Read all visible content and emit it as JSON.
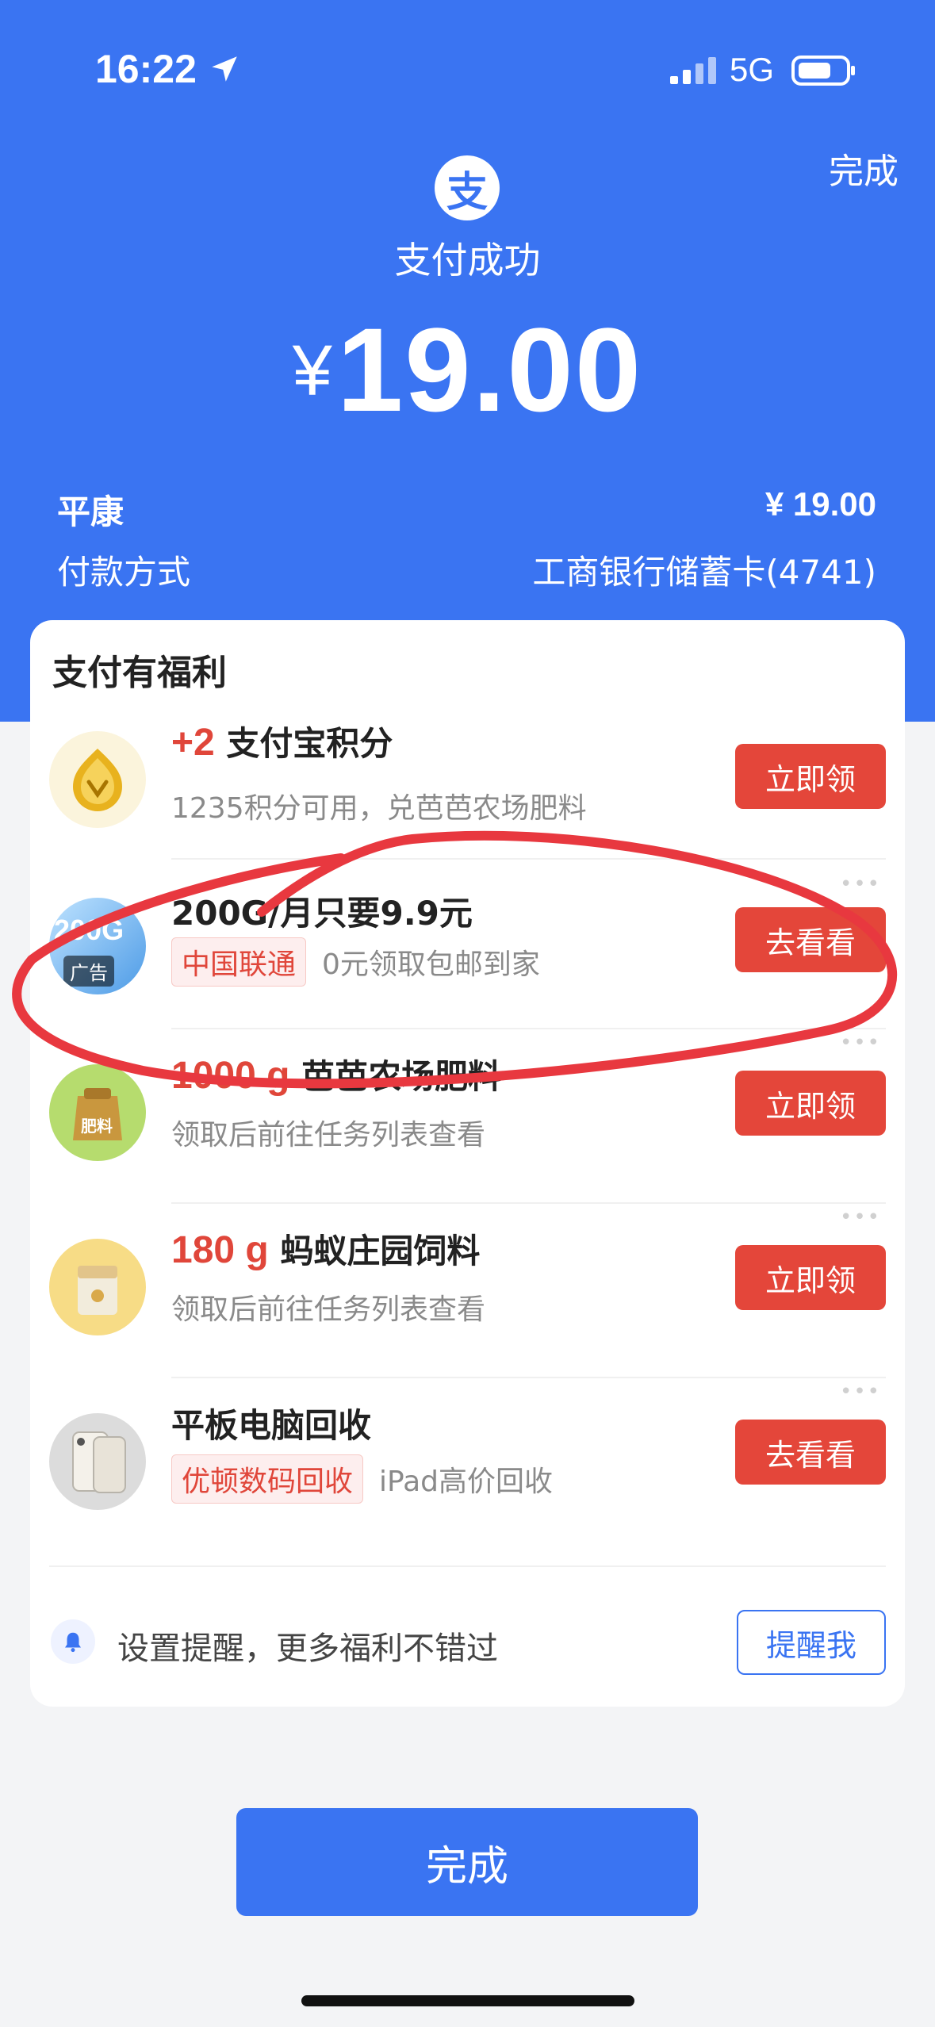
{
  "status_bar": {
    "time": "16:22",
    "network": "5G"
  },
  "header": {
    "done_label": "完成",
    "logo_char": "支",
    "status_text": "支付成功",
    "currency": "¥",
    "amount": "19.00"
  },
  "summary": {
    "merchant": "平康",
    "merchant_amount": "¥ 19.00",
    "method_label": "付款方式",
    "method_value": "工商银行储蓄卡(4741)"
  },
  "benefits": {
    "title": "支付有福利",
    "items": [
      {
        "highlight": "+2",
        "title": " 支付宝积分",
        "tag": "",
        "desc": "1235积分可用，兑芭芭农场肥料",
        "button": "立即领"
      },
      {
        "highlight": "",
        "title": "200G/月只要9.9元",
        "tag": "中国联通",
        "desc": "0元领取包邮到家",
        "button": "去看看",
        "ad_label": "广告",
        "avatar_text": "200G"
      },
      {
        "highlight": "1000 g",
        "title": " 芭芭农场肥料",
        "tag": "",
        "desc": "领取后前往任务列表查看",
        "button": "立即领",
        "avatar_text": "肥料"
      },
      {
        "highlight": "180 g",
        "title": " 蚂蚁庄园饲料",
        "tag": "",
        "desc": "领取后前往任务列表查看",
        "button": "立即领"
      },
      {
        "highlight": "",
        "title": "平板电脑回收",
        "tag": "优顿数码回收",
        "desc": "iPad高价回收",
        "button": "去看看"
      }
    ],
    "remind_text": "设置提醒，更多福利不错过",
    "remind_button": "提醒我"
  },
  "footer": {
    "done_button": "完成"
  },
  "colors": {
    "brand_blue": "#3a74f2",
    "action_red": "#e4463a",
    "annotation_red": "#e8383f"
  }
}
